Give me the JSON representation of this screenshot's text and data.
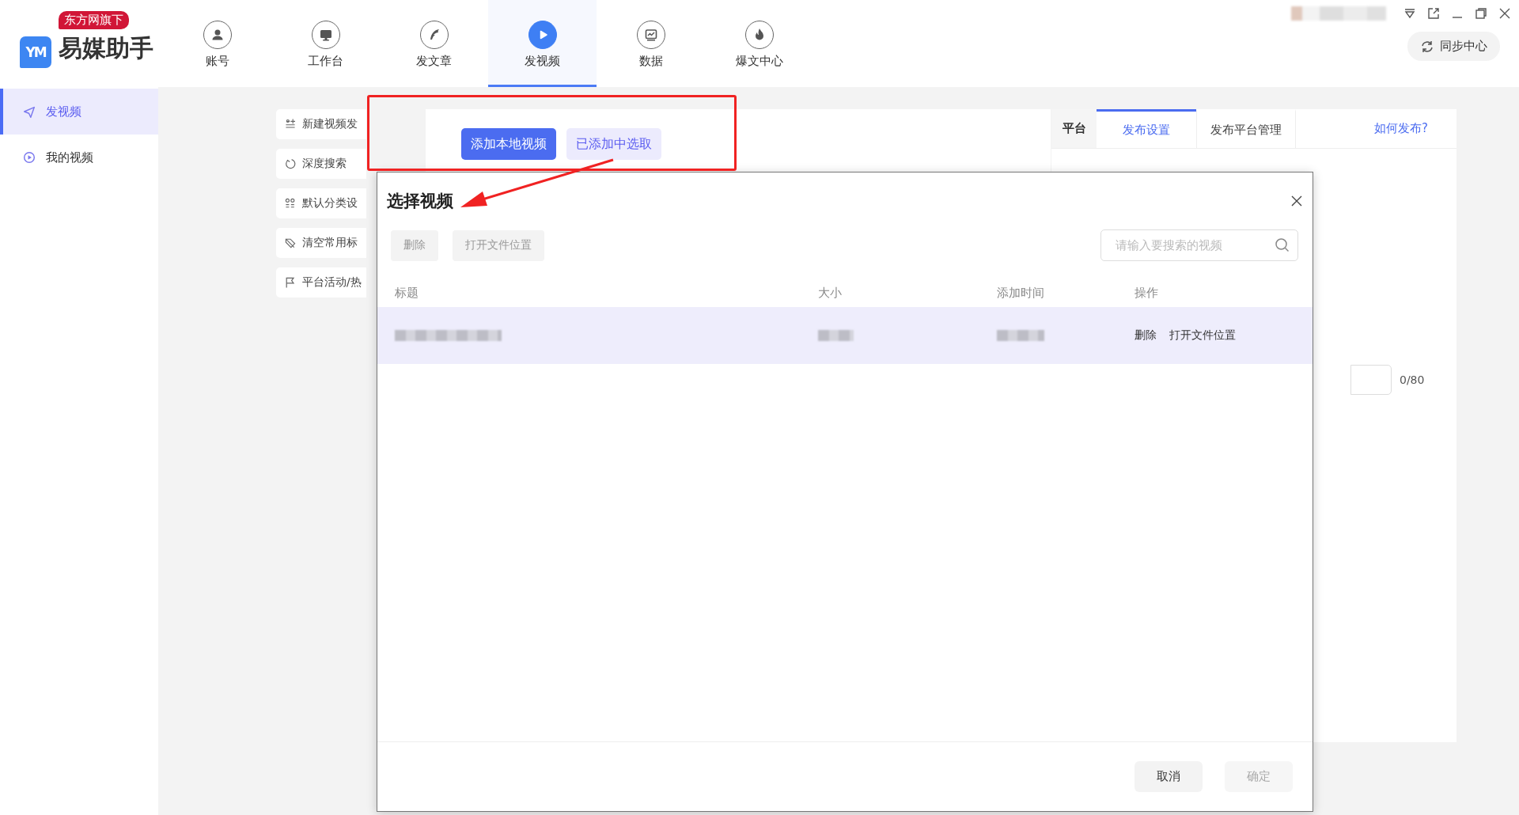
{
  "app": {
    "logo_mark": "YM",
    "badge": "东方网旗下",
    "name": "易媒助手"
  },
  "nav": [
    {
      "label": "账号",
      "selected": false
    },
    {
      "label": "工作台",
      "selected": false
    },
    {
      "label": "发文章",
      "selected": false
    },
    {
      "label": "发视频",
      "selected": true
    },
    {
      "label": "数据",
      "selected": false
    },
    {
      "label": "爆文中心",
      "selected": false
    }
  ],
  "sync_button": "同步中心",
  "sidebar": [
    {
      "label": "发视频",
      "selected": true
    },
    {
      "label": "我的视频",
      "selected": false
    }
  ],
  "tools": [
    "新建视频发",
    "深度搜索",
    "默认分类设",
    "清空常用标",
    "平台活动/热"
  ],
  "add_buttons": [
    {
      "label": "添加本地视频",
      "primary": true
    },
    {
      "label": "已添加中选取",
      "primary": false
    }
  ],
  "right_panel": {
    "column_label": "平台",
    "tabs": [
      {
        "label": "发布设置",
        "selected": true
      },
      {
        "label": "发布平台管理",
        "selected": false
      }
    ],
    "help_link": "如何发布?",
    "counter": "0/80"
  },
  "dialog": {
    "title": "选择视频",
    "toolbar": [
      {
        "label": "删除",
        "disabled": true
      },
      {
        "label": "打开文件位置",
        "disabled": true
      }
    ],
    "search": {
      "placeholder": "请输入要搜索的视频"
    },
    "columns": [
      "标题",
      "大小",
      "添加时间",
      "操作"
    ],
    "rows": [
      {
        "selected": true,
        "actions": [
          "删除",
          "打开文件位置"
        ]
      }
    ],
    "footer": [
      {
        "label": "取消",
        "disabled": false
      },
      {
        "label": "确定",
        "disabled": true
      }
    ]
  }
}
